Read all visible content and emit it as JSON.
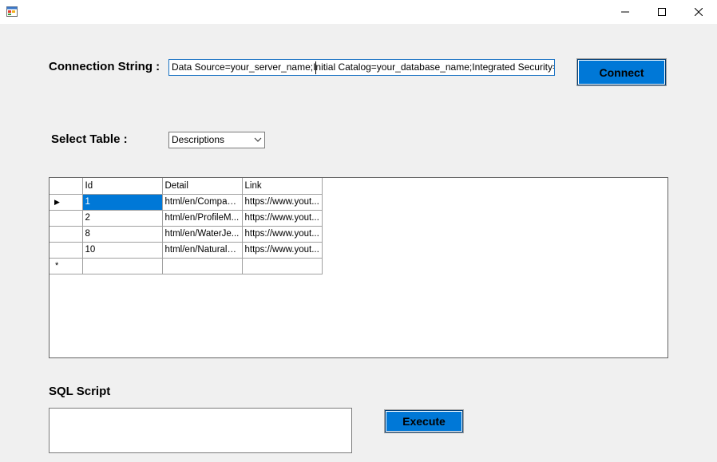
{
  "window": {
    "minimize_glyph": "─",
    "maximize_glyph": "☐",
    "close_glyph": "✕"
  },
  "connection": {
    "label": "Connection String :",
    "value": "Data Source=your_server_name;Initial Catalog=your_database_name;Integrated Security=True;Pooling=False",
    "button_label": "Connect"
  },
  "table_select": {
    "label": "Select Table :",
    "selected": "Descriptions"
  },
  "grid": {
    "columns": [
      "Id",
      "Detail",
      "Link"
    ],
    "rows": [
      {
        "id": "1",
        "detail": "html/en/Compact...",
        "link": "https://www.yout..."
      },
      {
        "id": "2",
        "detail": "html/en/ProfileM...",
        "link": "https://www.yout..."
      },
      {
        "id": "8",
        "detail": "html/en/WaterJe...",
        "link": "https://www.yout..."
      },
      {
        "id": "10",
        "detail": "html/en/NaturalS...",
        "link": "https://www.yout..."
      }
    ],
    "new_row_marker": "*",
    "current_row_marker": "▶"
  },
  "sql": {
    "label": "SQL Script",
    "value": "",
    "button_label": "Execute"
  },
  "colors": {
    "accent": "#0078d7",
    "background": "#f0f0f0"
  }
}
